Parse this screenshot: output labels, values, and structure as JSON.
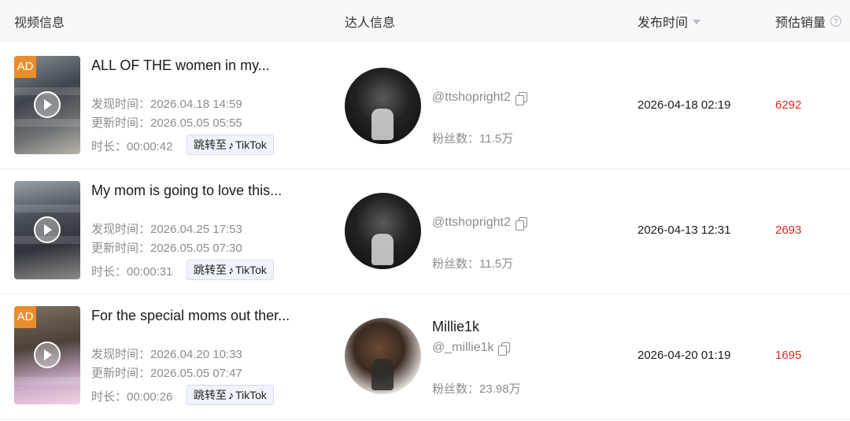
{
  "header": {
    "video_info": "视频信息",
    "creator_info": "达人信息",
    "publish_time": "发布时间",
    "estimated_sales": "预估销量"
  },
  "rows": [
    {
      "ad_label": "AD",
      "title": "ALL OF THE women in my...",
      "discover_time": "发现时间：2026.04.18 14:59",
      "update_time": "更新时间：2026.05.05 05:55",
      "duration": "时长：00:00:42",
      "jump_label": "跳转至",
      "tiktok_label": "TikTok",
      "creator_name": "",
      "handle": "@ttshopright2",
      "fans": "粉丝数：11.5万",
      "publish_time": "2026-04-18 02:19",
      "sales": "6292"
    },
    {
      "ad_label": "",
      "title": "My mom is going to love this...",
      "discover_time": "发现时间：2026.04.25 17:53",
      "update_time": "更新时间：2026.05.05 07:30",
      "duration": "时长：00:00:31",
      "jump_label": "跳转至",
      "tiktok_label": "TikTok",
      "creator_name": "",
      "handle": "@ttshopright2",
      "fans": "粉丝数：11.5万",
      "publish_time": "2026-04-13 12:31",
      "sales": "2693"
    },
    {
      "ad_label": "AD",
      "title": "For the special moms out ther...",
      "discover_time": "发现时间：2026.04.20 10:33",
      "update_time": "更新时间：2026.05.05 07:47",
      "duration": "时长：00:00:26",
      "jump_label": "跳转至",
      "tiktok_label": "TikTok",
      "creator_name": "Millie1k",
      "handle": "@_millie1k",
      "fans": "粉丝数：23.98万",
      "publish_time": "2026-04-20 01:19",
      "sales": "1695"
    }
  ],
  "icons": {
    "sort": "sort-caret-icon",
    "help": "question-circle-icon",
    "play": "play-icon",
    "copy": "copy-icon",
    "tiktok": "tiktok-logo-icon"
  },
  "colors": {
    "accent_red": "#e0261f",
    "ad_orange": "#e98d2c",
    "muted_text": "#8a8c90",
    "header_bg": "#f7f8fa"
  }
}
